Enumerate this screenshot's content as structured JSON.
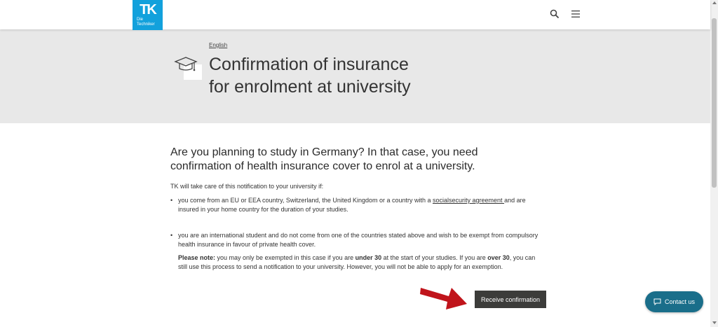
{
  "header": {
    "logo_text": "TK",
    "logo_sub_1": "Die",
    "logo_sub_2": "Techniker",
    "icons": [
      "search-icon",
      "menu-icon"
    ]
  },
  "hero": {
    "language_link": "English",
    "title_line1": "Confirmation of insurance",
    "title_line2": "for enrolment at university",
    "icon": "graduation-cap-icon"
  },
  "main": {
    "lead": "Are you planning to study in Germany? In that case, you need confirmation of health insurance cover to enrol at a university.",
    "intro": "TK will take care of this notification to your university if:",
    "condition1_pre": "you come from an EU or EEA country, Switzerland, the United Kingdom or a country with a ",
    "condition1_link": "socialsecurity agreement ",
    "condition1_post": "and are insured in your home country for the duration of your studies.",
    "condition2": "you are an international student and do not come from one of the countries stated above and wish to be exempt from compulsory health insurance in favour of private health cover.",
    "note_label": "Please note:",
    "note_1": " you may only be exempted in this case if you are ",
    "note_under": "under 30",
    "note_2": " at the start of your studies. If you are ",
    "note_over": "over 30",
    "note_3": ", you can still use this process to send a notification to your university. However, you will not be able to apply for an exemption.",
    "receive_button": "Receive confirmation"
  },
  "contact_button": "Contact us",
  "colors": {
    "brand": "#12a1dc",
    "hero_bg": "#e8e8e8",
    "button_dark": "#3c3c3a",
    "contact_bg": "#1a6e8a",
    "arrow_red": "#c0141b"
  }
}
